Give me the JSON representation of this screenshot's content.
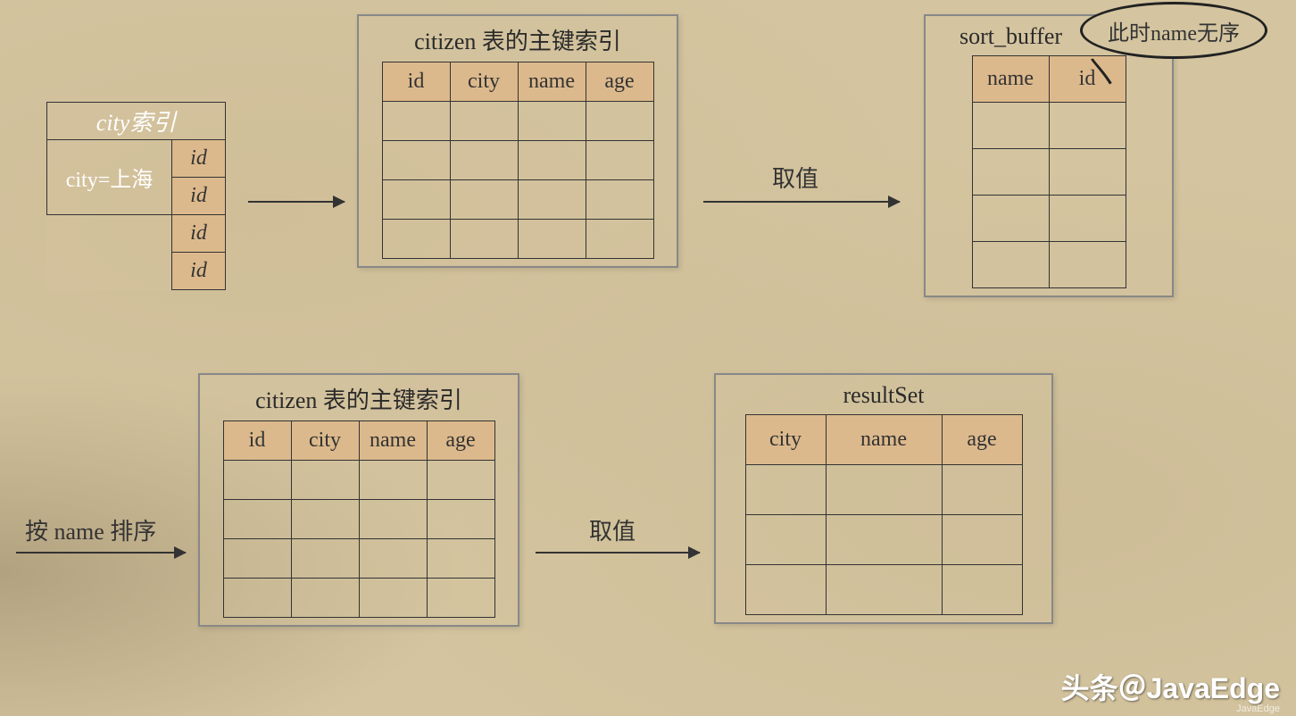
{
  "cityIndex": {
    "header": "city索引",
    "filter": "city=上海",
    "ids": [
      "id",
      "id",
      "id",
      "id"
    ]
  },
  "primaryTop": {
    "title": "citizen 表的主键索引",
    "cols": [
      "id",
      "city",
      "name",
      "age"
    ],
    "rows": 4
  },
  "sortBuffer": {
    "title": "sort_buffer",
    "cols": [
      "name",
      "id"
    ],
    "rows": 4,
    "bubble": "此时name无序"
  },
  "primaryBottom": {
    "title": "citizen 表的主键索引",
    "cols": [
      "id",
      "city",
      "name",
      "age"
    ],
    "rows": 4
  },
  "resultSet": {
    "title": "resultSet",
    "cols": [
      "city",
      "name",
      "age"
    ],
    "rows": 3
  },
  "arrows": {
    "a1": "",
    "a2": "取值",
    "a3": "按 name 排序",
    "a4": "取值"
  },
  "watermark": "头条＠JavaEdge",
  "watermarkSmall": "JavaEdge"
}
